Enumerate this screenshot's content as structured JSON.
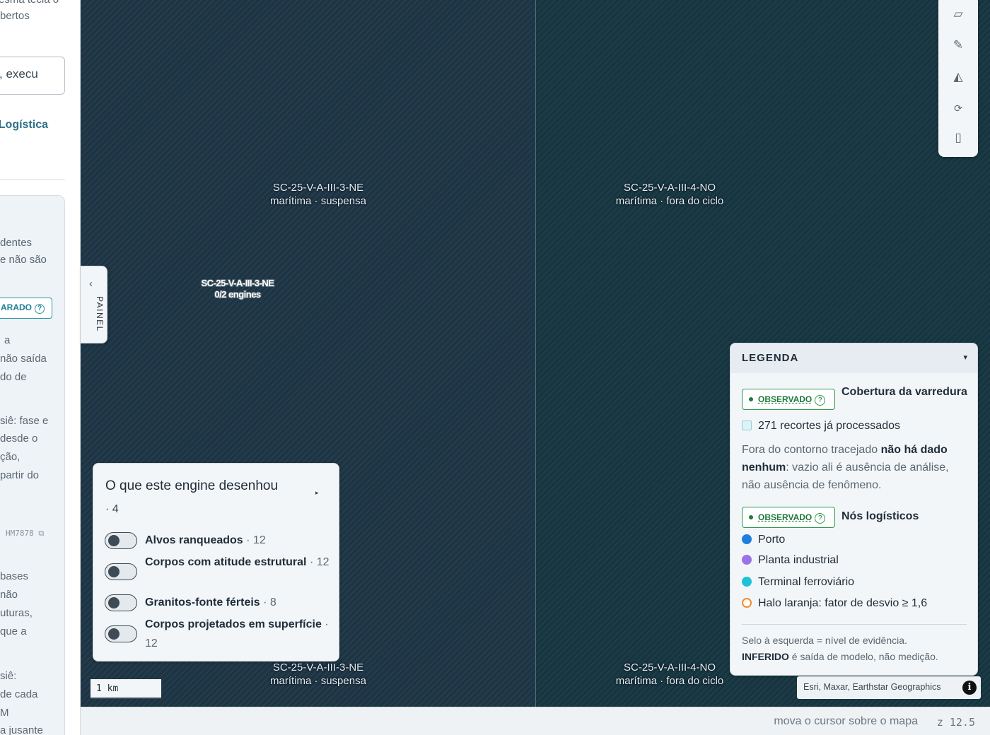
{
  "sidebar": {
    "frag1": "esma tecla o",
    "frag2": "bertos",
    "input_value": ", execu",
    "link": "Logística",
    "para1": [
      "dentes",
      "e não são"
    ],
    "badge": "ARADO",
    "para2": [
      "a",
      "não saída",
      "do de"
    ],
    "para3": [
      "siê: fase e",
      "desde o",
      "ção,",
      "partir do"
    ],
    "code": "HM7878 ⧉",
    "para4": [
      "bases",
      "não",
      "uturas,",
      "que a"
    ],
    "para5": [
      "siê:",
      "de cada",
      "M",
      "a jusante"
    ]
  },
  "map": {
    "tiles": [
      {
        "name": "SC-25-V-A-III-3-NE",
        "sub": "marítima · suspensa"
      },
      {
        "name": "SC-25-V-A-III-4-NO",
        "sub": "marítima · fora do ciclo"
      },
      {
        "name": "SC-25-V-A-III-3-NE",
        "sub": "marítima · suspensa"
      },
      {
        "name": "SC-25-V-A-III-4-NO",
        "sub": "marítima · fora do ciclo"
      }
    ],
    "marker": {
      "name": "SC-25-V-A-III-3-NE",
      "sub": "0/2 engines"
    }
  },
  "toolbar": {
    "tools": [
      {
        "icon": "parallelogram-icon",
        "glyph": "▱"
      },
      {
        "icon": "pencil-icon",
        "glyph": "✎"
      },
      {
        "icon": "terrain-icon",
        "glyph": "◭"
      },
      {
        "icon": "refresh-icon",
        "glyph": "⟳"
      },
      {
        "icon": "ruler-icon",
        "glyph": "▯"
      }
    ]
  },
  "painel": {
    "label": "PAINEL",
    "chevron": "‹"
  },
  "engine": {
    "title": "O que este engine desenhou",
    "count": "· 4",
    "caret": "▸",
    "items": [
      {
        "label": "Alvos ranqueados",
        "count": "· 12",
        "checked": false
      },
      {
        "label": "Corpos com atitude estrutural",
        "count": "· 12",
        "checked": false
      },
      {
        "label": "Granitos-fonte férteis",
        "count": "· 8",
        "checked": false
      },
      {
        "label": "Corpos projetados em superfície",
        "count": "· 12",
        "checked": false
      }
    ]
  },
  "scale": "1 km",
  "legend": {
    "title": "LEGENDA",
    "caret": "▾",
    "badge_label": "OBSERVADO",
    "badge_q": "?",
    "coverage_title": "Cobertura da varredura",
    "coverage_row": "271 recortes já processados",
    "note_pre": "Fora do contorno tracejado ",
    "note_bold": "não há dado nenhum",
    "note_post": ": vazio ali é ausência de análise, não ausência de fenômeno.",
    "nodes_title": "Nós logísticos",
    "nodes": [
      {
        "label": "Porto",
        "color": "#1f7fe0",
        "kind": "dot"
      },
      {
        "label": "Planta industrial",
        "color": "#9b73e6",
        "kind": "dot"
      },
      {
        "label": "Terminal ferroviário",
        "color": "#1fc1d6",
        "kind": "dot"
      },
      {
        "label": "Halo laranja: fator de desvio ≥ 1,6",
        "color": "#f28c28",
        "kind": "ring"
      }
    ],
    "foot_line1": "Selo à esquerda = nível de evidência.",
    "foot_bold": "INFERIDO",
    "foot_line2": " é saída de modelo, não medição."
  },
  "attribution": {
    "text": "Esri, Maxar, Earthstar Geographics",
    "info": "i"
  },
  "status": {
    "hint": "mova o cursor sobre o mapa",
    "zoom": "z 12.5"
  }
}
